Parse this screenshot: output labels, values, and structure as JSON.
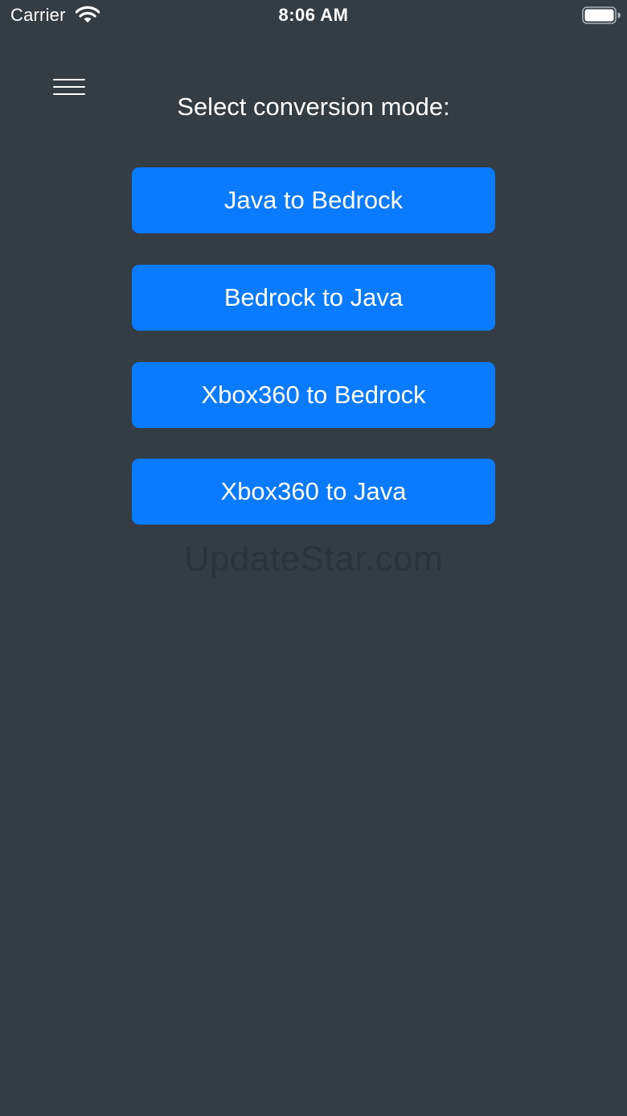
{
  "status_bar": {
    "carrier": "Carrier",
    "time": "8:06 AM",
    "wifi_icon": "wifi-icon",
    "battery_icon": "battery-full-icon"
  },
  "header": {
    "menu_icon": "hamburger-menu-icon",
    "prompt": "Select conversion mode:"
  },
  "modes": [
    {
      "label": "Java to Bedrock"
    },
    {
      "label": "Bedrock to Java"
    },
    {
      "label": "Xbox360 to Bedrock"
    },
    {
      "label": "Xbox360 to Java"
    }
  ],
  "watermark": "UpdateStar.com",
  "colors": {
    "background": "#333d43",
    "accent": "#0a7aff",
    "text": "#ffffff"
  }
}
